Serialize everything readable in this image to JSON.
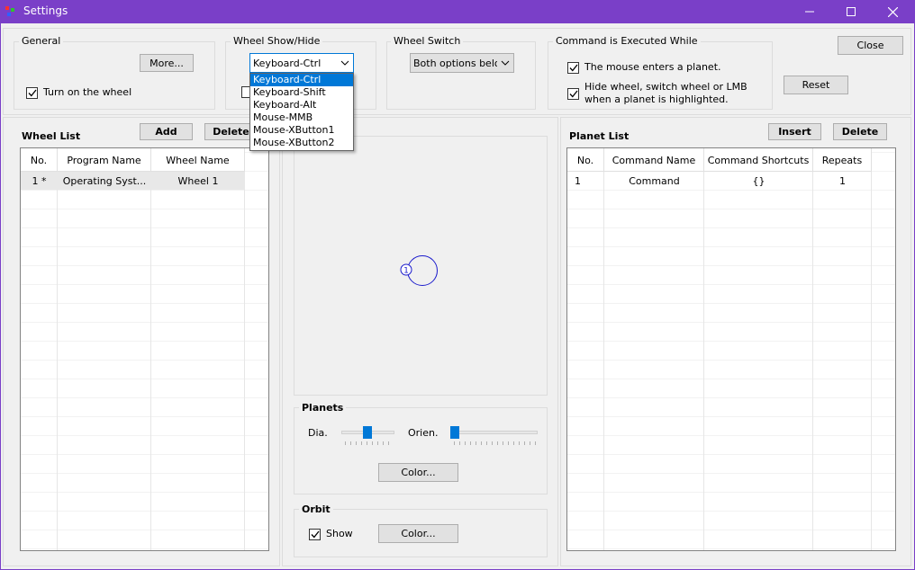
{
  "window": {
    "title": "Settings",
    "accent": "#7a3fc8"
  },
  "icons": {
    "app": "app-icon",
    "minimize": "minimize-icon",
    "maximize": "maximize-icon",
    "close": "close-icon",
    "chevron": "chevron-down-icon",
    "check": "check-icon"
  },
  "general": {
    "label": "General",
    "more_button": "More...",
    "turn_on_wheel": "Turn on the wheel",
    "turn_on_checked": true
  },
  "wheel_show": {
    "label": "Wheel Show/Hide",
    "selected": "Keyboard-Ctrl",
    "options": [
      "Keyboard-Ctrl",
      "Keyboard-Shift",
      "Keyboard-Alt",
      "Mouse-MMB",
      "Mouse-XButton1",
      "Mouse-XButton2"
    ]
  },
  "wheel_switch": {
    "label": "Wheel Switch",
    "selected": "Both options below"
  },
  "command_exec": {
    "label": "Command is Executed While",
    "option1": "The mouse enters a planet.",
    "option2_line1": "Hide wheel, switch wheel or LMB",
    "option2_line2": "when a planet is highlighted."
  },
  "top_buttons": {
    "close": "Close",
    "reset": "Reset"
  },
  "wheel_list": {
    "title": "Wheel List",
    "add": "Add",
    "delete": "Delete",
    "columns": [
      "No.",
      "Program Name",
      "Wheel Name"
    ],
    "rows": [
      {
        "no": "1 *",
        "program": "Operating Syst...",
        "wheel": "Wheel 1"
      }
    ]
  },
  "preview": {
    "planet_number": "1",
    "planet_color": "#1a1acc"
  },
  "planets": {
    "title": "Planets",
    "dia_label": "Dia.",
    "orien_label": "Orien.",
    "color_button": "Color..."
  },
  "orbit": {
    "title": "Orbit",
    "show_label": "Show",
    "show_checked": true,
    "color_button": "Color..."
  },
  "planet_list": {
    "title": "Planet List",
    "insert": "Insert",
    "delete": "Delete",
    "columns": [
      "No.",
      "Command Name",
      "Command Shortcuts",
      "Repeats"
    ],
    "rows": [
      {
        "no": "1",
        "name": "Command",
        "shortcuts": "{}",
        "repeats": "1"
      }
    ]
  }
}
